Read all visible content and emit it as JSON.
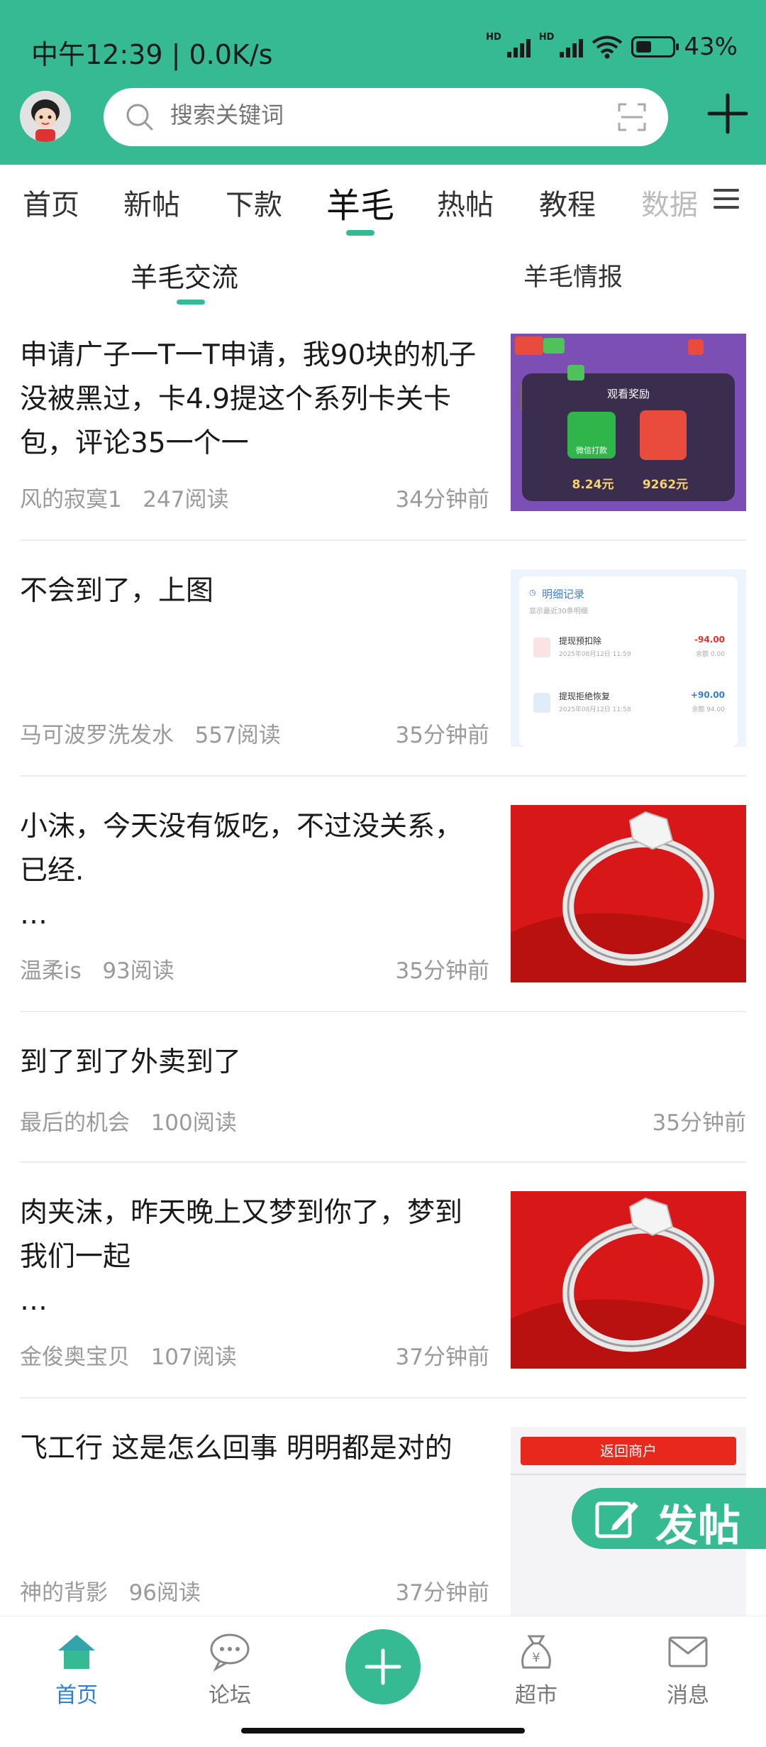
{
  "status_bar": {
    "time": "中午12:39 | 0.0K/s",
    "battery": "43%",
    "battery_level": 0.43
  },
  "search": {
    "placeholder": "搜索关键词"
  },
  "tabs": [
    {
      "label": "首页",
      "state": "inactive"
    },
    {
      "label": "新帖",
      "state": "inactive"
    },
    {
      "label": "下款",
      "state": "inactive"
    },
    {
      "label": "羊毛",
      "state": "active"
    },
    {
      "label": "热帖",
      "state": "inactive"
    },
    {
      "label": "教程",
      "state": "inactive"
    },
    {
      "label": "数据",
      "state": "faded"
    }
  ],
  "subtabs": [
    {
      "label": "羊毛交流",
      "state": "active"
    },
    {
      "label": "羊毛情报",
      "state": "inactive"
    }
  ],
  "posts": [
    {
      "title": "申请广子一T一T申请，我90块的机子没被黑过，卡4.9提这个系列卡关卡包，评论35一个一",
      "author": "风的寂寞1",
      "reads": "247阅读",
      "time": "34分钟前",
      "thumb": {
        "type": "reward",
        "heading": "观看奖励",
        "badge": "微信打款",
        "amount_left": "8.24元",
        "amount_right": "9262元"
      }
    },
    {
      "title": "不会到了，上图",
      "author": "马可波罗洗发水",
      "reads": "557阅读",
      "time": "35分钟前",
      "thumb": {
        "type": "records",
        "heading": "明细记录",
        "sub": "显示最近30条明细",
        "rows": [
          {
            "name": "提现预扣除",
            "date": "2025年08月12日 11:59",
            "amount": "-94.00",
            "balance": "余额 0.00"
          },
          {
            "name": "提现拒绝恢复",
            "date": "2025年08月12日 11:58",
            "amount": "+90.00",
            "balance": "余额 94.00"
          }
        ]
      }
    },
    {
      "title": "小沫，今天没有饭吃，不过没关系，已经.\n…",
      "author": "温柔is",
      "reads": "93阅读",
      "time": "35分钟前",
      "thumb": {
        "type": "ring"
      }
    },
    {
      "title": "到了到了外卖到了",
      "author": "最后的机会",
      "reads": "100阅读",
      "time": "35分钟前",
      "thumb": null
    },
    {
      "title": "肉夹沫，昨天晚上又梦到你了，梦到我们一起\n…",
      "author": "金俊奥宝贝",
      "reads": "107阅读",
      "time": "37分钟前",
      "thumb": {
        "type": "ring"
      }
    },
    {
      "title": "飞工行 这是怎么回事 明明都是对的",
      "author": "神的背影",
      "reads": "96阅读",
      "time": "37分钟前",
      "thumb": {
        "type": "merchant",
        "button": "返回商户"
      }
    }
  ],
  "fab": {
    "label": "发帖"
  },
  "bottom_nav": [
    {
      "label": "首页",
      "icon": "home-icon",
      "active": true
    },
    {
      "label": "论坛",
      "icon": "forum-icon",
      "active": false
    },
    {
      "label": "",
      "icon": "plus-icon",
      "active": false
    },
    {
      "label": "超市",
      "icon": "money-bag-icon",
      "active": false
    },
    {
      "label": "消息",
      "icon": "mail-icon",
      "active": false
    }
  ],
  "colors": {
    "accent": "#36BA94",
    "active_nav": "#2d7fd3",
    "reward_bg": "#7b4fb3",
    "ring_bg": "#d81818",
    "merchant_btn": "#e8281d"
  }
}
